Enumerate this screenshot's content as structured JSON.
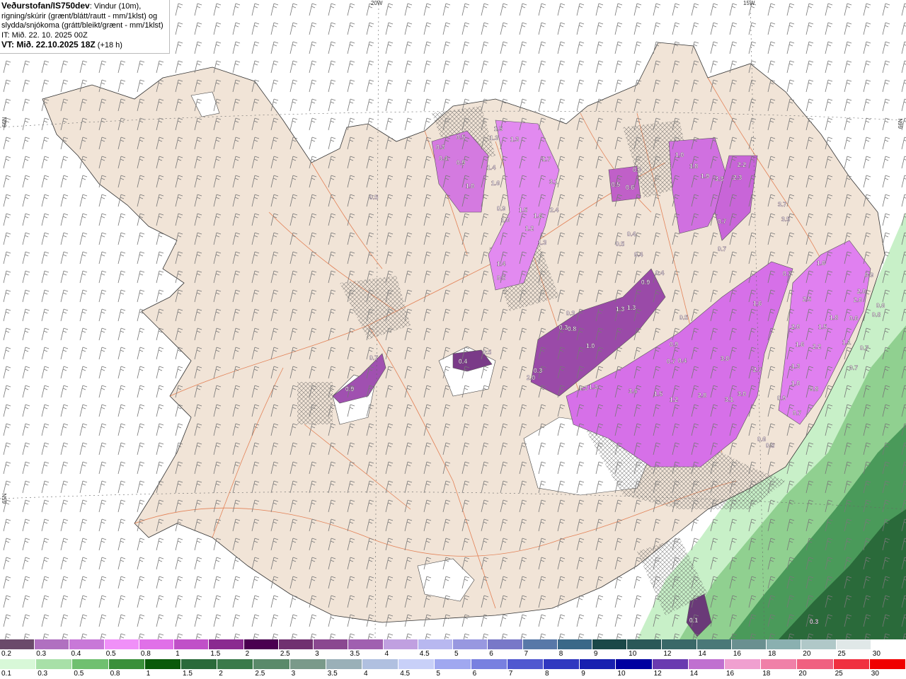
{
  "header": {
    "model": "Veðurstofan/IS750dev",
    "description_1": ": Vindur (10m),",
    "description_2": "rigning/skúrir (grænt/blátt/rautt - mm/1klst) og",
    "description_3": "slydda/snjókoma (grátt/bleikt/grænt - mm/1klst)",
    "it_line": "IT: Mið. 22. 10. 2025 00Z",
    "vt_label": "VT: Mið. 22.10.2025 18Z",
    "vt_lead": " (+18 h)"
  },
  "grid_labels": {
    "lon_20w": "20W",
    "lon_15w": "15W",
    "lat_66n_left": "66N",
    "lat_66n_right": "66N",
    "lat_65n_left": "65N"
  },
  "precip_values": [
    "0.5",
    "0.4",
    "0.3",
    "1.3",
    "1.5",
    "1.3",
    "0.9",
    "1.0",
    "1.4",
    "1.6",
    "0.9",
    "1.0",
    "1.5",
    "1.7",
    "3.1",
    "2.4",
    "1.6",
    "1.2",
    "1.3",
    "1.4",
    "0.5",
    "0.5",
    "0.6",
    "0.3",
    "1.0",
    "1.8",
    "1.9",
    "3.3",
    "2.2",
    "2.3",
    "0.4",
    "0.5",
    "0.4",
    "0.4",
    "1.3",
    "1.3",
    "0.7",
    "0.7",
    "3.7",
    "3.5",
    "0.7",
    "1.6",
    "0.3",
    "0.3",
    "1.0",
    "0.5",
    "0.9",
    "0.7",
    "0.4",
    "3.0",
    "2.7",
    "2.5",
    "2.0",
    "2.2",
    "1.6",
    "1.8",
    "1.5",
    "2.0",
    "2.0",
    "0.6",
    "1.1",
    "1.6",
    "0.9",
    "0.8",
    "0.6",
    "0.7",
    "1.3",
    "1.0",
    "0.8",
    "0.9",
    "0.7",
    "0.7",
    "1.3",
    "1.3",
    "3.4",
    "1.5",
    "1.2",
    "2.8",
    "3.1",
    "3.0",
    "0.6",
    "0.5",
    "0.7",
    "0.9",
    "0.5",
    "0.4",
    "0.5",
    "0.1",
    "0.3",
    "2.0",
    "0.3",
    "0.8",
    "0.9",
    "0.6"
  ],
  "legend_snow": {
    "labels": [
      "0.2",
      "0.3",
      "0.4",
      "0.5",
      "0.8",
      "1",
      "1.5",
      "2",
      "2.5",
      "3",
      "3.5",
      "4",
      "4.5",
      "5",
      "6",
      "7",
      "8",
      "9",
      "10",
      "12",
      "14",
      "16",
      "18",
      "20",
      "25",
      "30"
    ],
    "colors": [
      "#6a4a6a",
      "#b070c0",
      "#c878d8",
      "#f090f8",
      "#e070e8",
      "#c050c8",
      "#8a2a90",
      "#4a0050",
      "#703070",
      "#8a4890",
      "#a060b0",
      "#c0a0e0",
      "#b8b8f0",
      "#9898e0",
      "#7878c8",
      "#5878a8",
      "#3a6888",
      "#1a4848",
      "#2a5858",
      "#3a6868",
      "#4a7878",
      "#6a9090",
      "#8ab0b0",
      "#b0c8c8",
      "#e0e8e8",
      "#ffffff"
    ]
  },
  "legend_rain": {
    "labels": [
      "0.1",
      "0.3",
      "0.5",
      "0.8",
      "1",
      "1.5",
      "2",
      "2.5",
      "3",
      "3.5",
      "4",
      "4.5",
      "5",
      "6",
      "7",
      "8",
      "9",
      "10",
      "12",
      "14",
      "16",
      "18",
      "20",
      "25",
      "30"
    ],
    "colors": [
      "#d8f8d8",
      "#a8e0a8",
      "#70c070",
      "#3a903a",
      "#0a5a0a",
      "#2a6a3a",
      "#3a7a4a",
      "#5a8a6a",
      "#7a9a8a",
      "#9ab0b8",
      "#b0c0e0",
      "#c8d0f8",
      "#a0a8f0",
      "#7880e0",
      "#5058d0",
      "#3038c0",
      "#1820b0",
      "#0000a0",
      "#6a3ab0",
      "#c070d0",
      "#f0a0d0",
      "#f080a8",
      "#f06080",
      "#f03040",
      "#f00000"
    ]
  }
}
